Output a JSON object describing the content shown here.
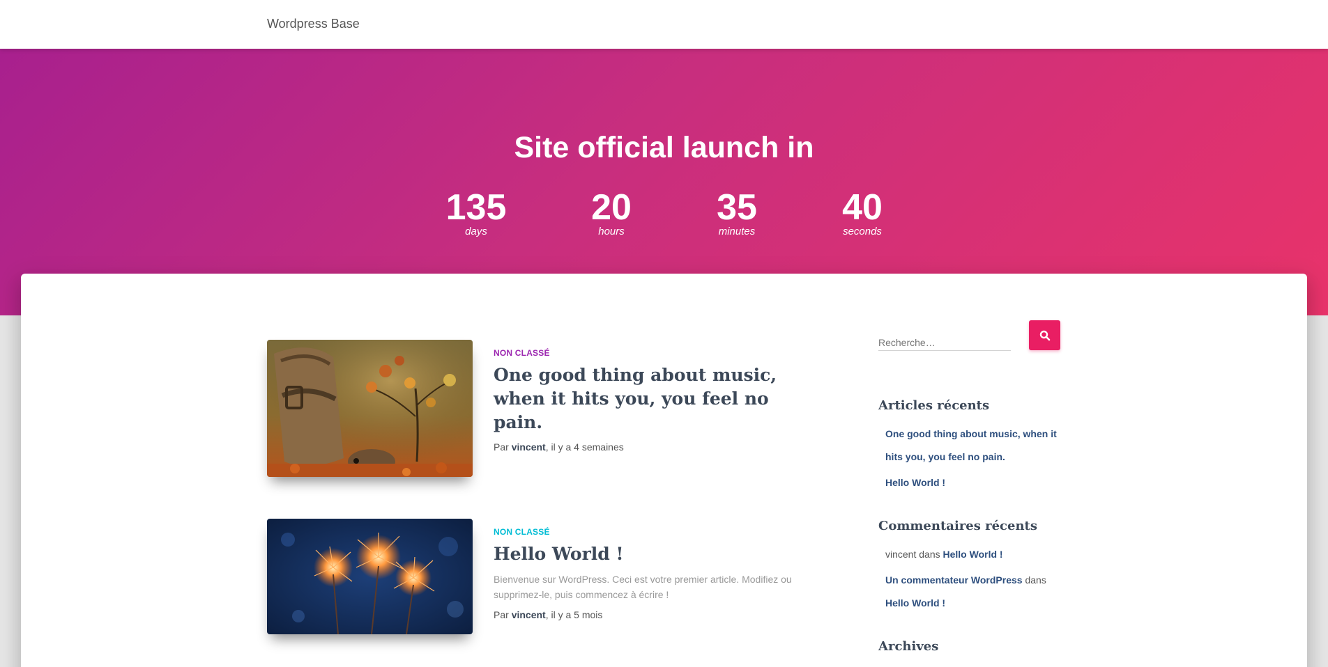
{
  "navbar": {
    "brand": "Wordpress Base"
  },
  "hero": {
    "title": "Site official launch in",
    "countdown": [
      {
        "value": "135",
        "label": "days"
      },
      {
        "value": "20",
        "label": "hours"
      },
      {
        "value": "35",
        "label": "minutes"
      },
      {
        "value": "40",
        "label": "seconds"
      }
    ]
  },
  "posts": [
    {
      "category": "Non classé",
      "category_color": "#9c27b0",
      "title": "One good thing about music, when it hits you, you feel no pain.",
      "excerpt": "",
      "meta_prefix": "Par ",
      "author": "vincent",
      "meta_suffix": ", il y a 4 semaines",
      "image": "hedgehog-autumn-photo"
    },
    {
      "category": "Non classé",
      "category_color": "#00bcd4",
      "title": "Hello World !",
      "excerpt": "Bienvenue sur WordPress. Ceci est votre premier article. Modifiez ou supprimez-le, puis commencez à écrire !",
      "meta_prefix": "Par ",
      "author": "vincent",
      "meta_suffix": ", il y a 5 mois",
      "image": "sparklers-photo"
    }
  ],
  "sidebar": {
    "search_placeholder": "Recherche…",
    "search_icon": "search-icon",
    "recent_posts": {
      "title": "Articles récents",
      "items": [
        "One good thing about music, when it hits you, you feel no pain.",
        "Hello World !"
      ]
    },
    "recent_comments": {
      "title": "Commentaires récents",
      "items": [
        {
          "author": "vincent",
          "connector": " dans ",
          "post": "Hello World !"
        },
        {
          "author": "Un commentateur WordPress",
          "connector": " dans ",
          "post": "Hello World !"
        }
      ]
    },
    "archives": {
      "title": "Archives"
    }
  },
  "colors": {
    "accent": "#e91e63",
    "gradient_start": "#a8208e",
    "gradient_end": "#e8336a",
    "link": "#2e4f7e"
  }
}
